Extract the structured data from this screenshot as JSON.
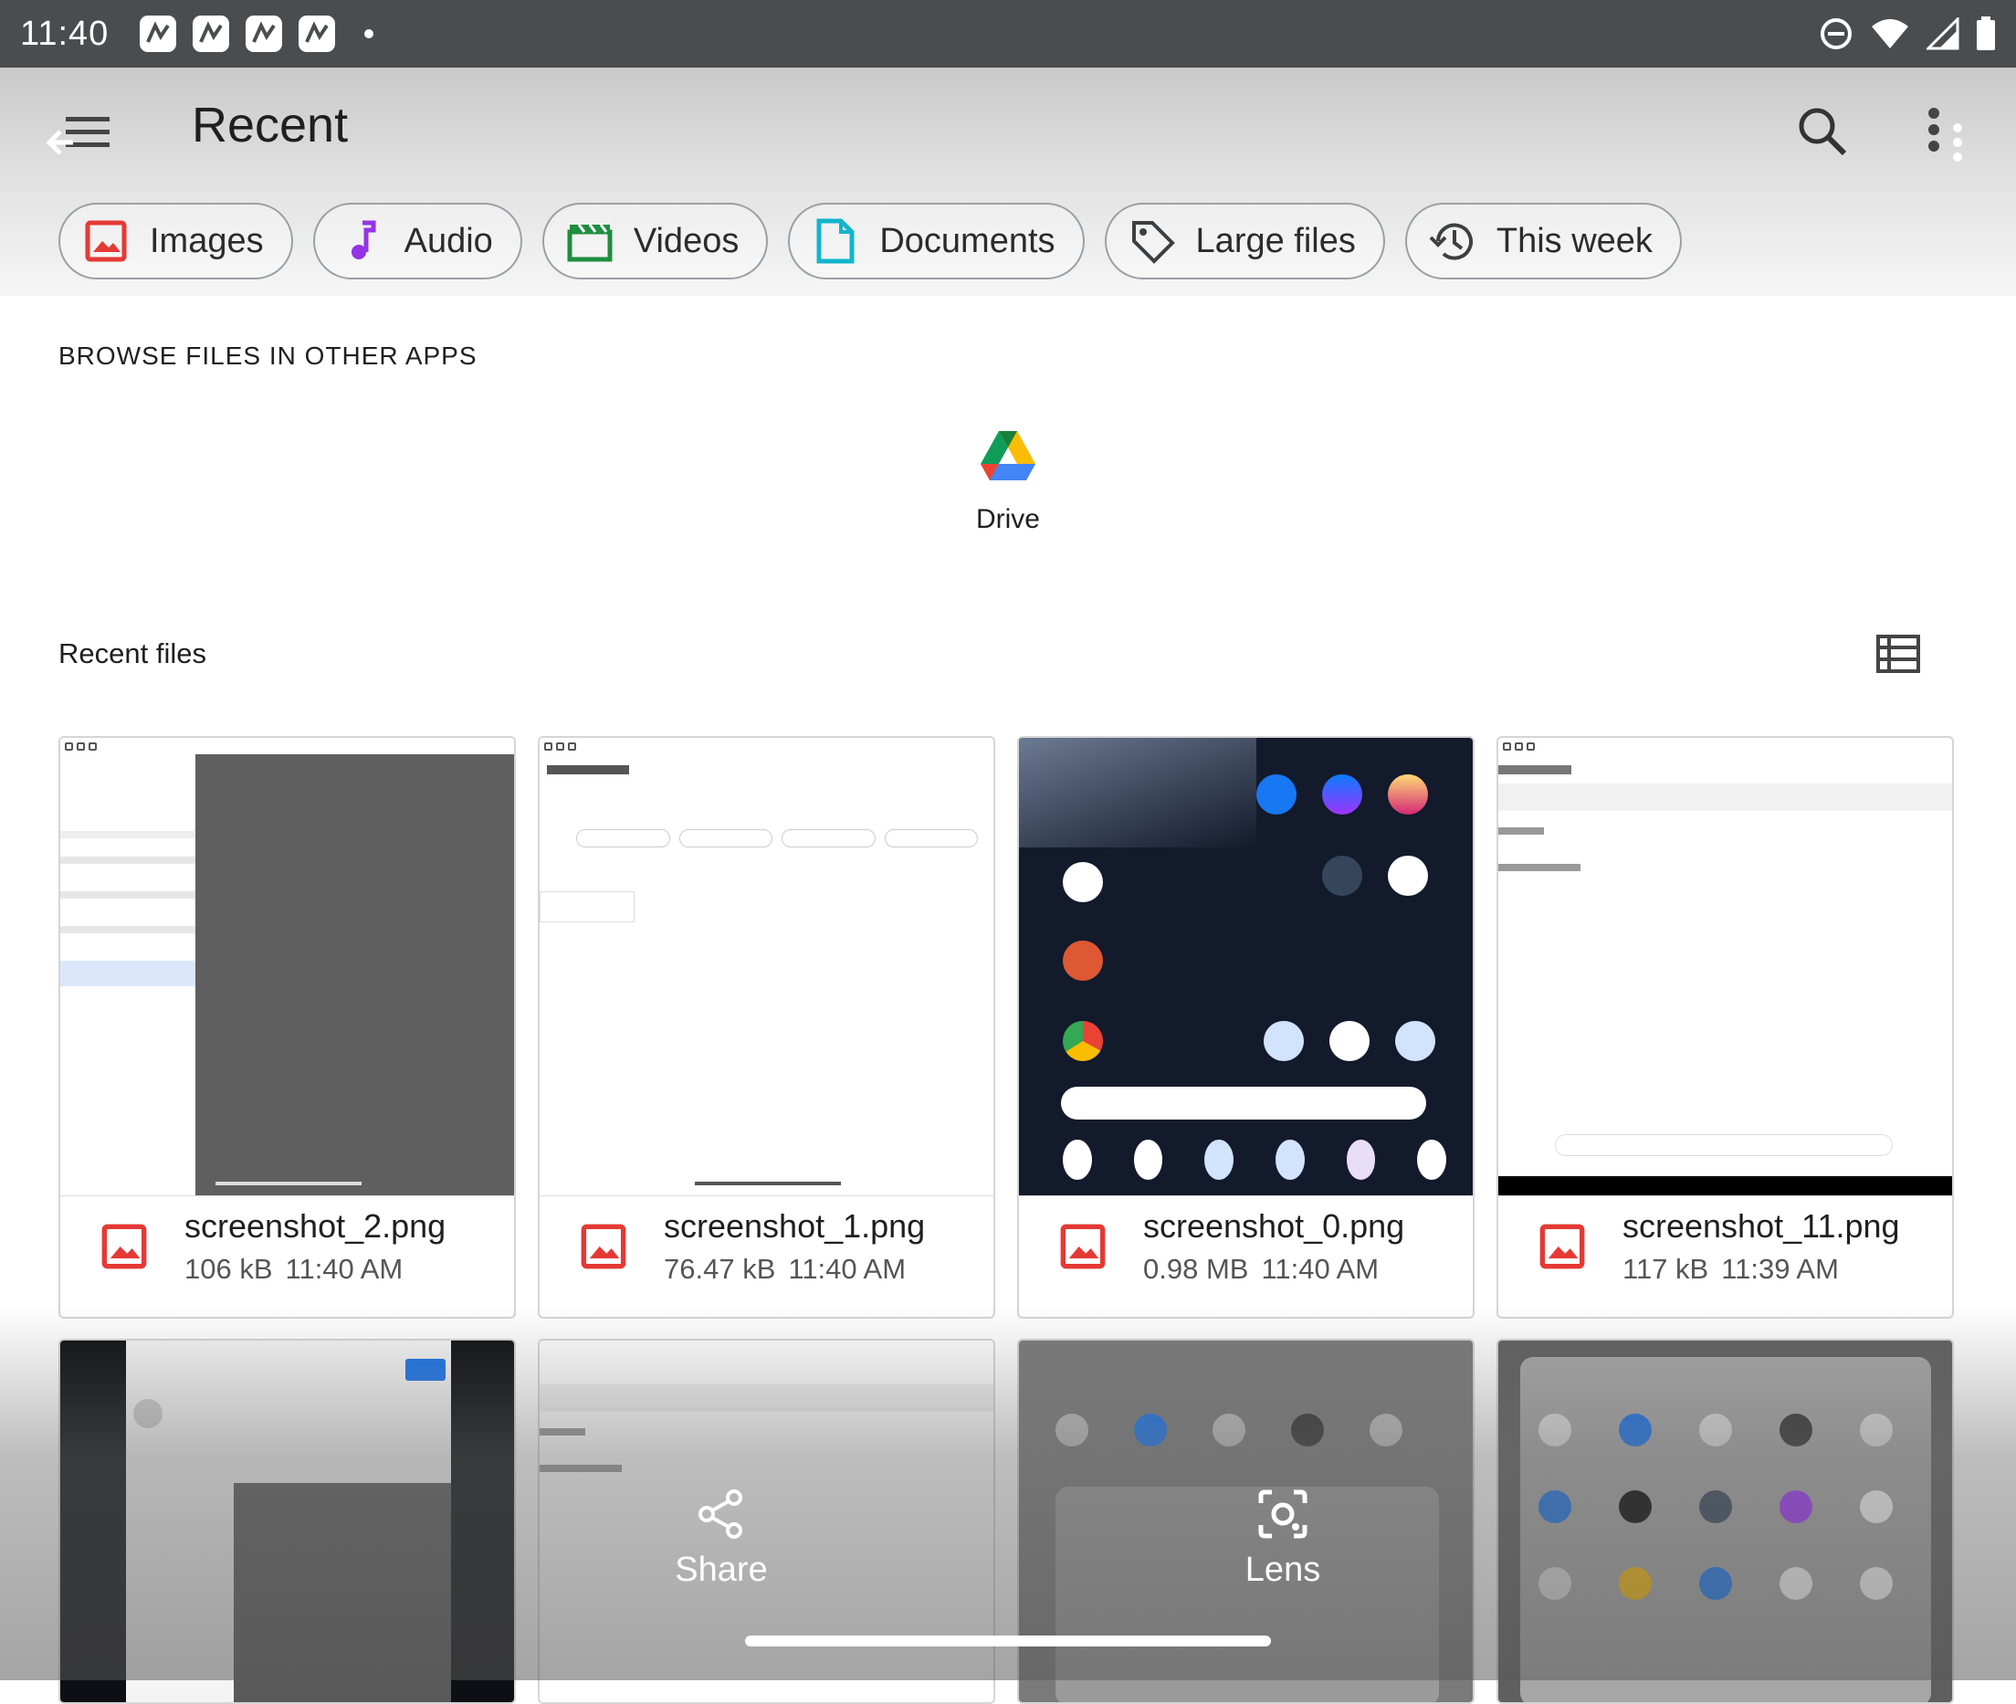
{
  "status_bar": {
    "time": "11:40"
  },
  "header": {
    "title": "Recent"
  },
  "chips": [
    {
      "label": "Images",
      "icon": "image-icon",
      "color": "#e53935"
    },
    {
      "label": "Audio",
      "icon": "music-note-icon",
      "color": "#9334e6"
    },
    {
      "label": "Videos",
      "icon": "clapperboard-icon",
      "color": "#1e8e3e"
    },
    {
      "label": "Documents",
      "icon": "document-icon",
      "color": "#12b5cb"
    },
    {
      "label": "Large files",
      "icon": "tag-icon",
      "color": "#3c4043"
    },
    {
      "label": "This week",
      "icon": "history-icon",
      "color": "#3c4043"
    }
  ],
  "browse": {
    "title": "BROWSE FILES IN OTHER APPS",
    "apps": [
      {
        "label": "Drive"
      }
    ]
  },
  "recent": {
    "title": "Recent files",
    "files": [
      {
        "name": "screenshot_2.png",
        "size": "106 kB",
        "time": "11:40 AM"
      },
      {
        "name": "screenshot_1.png",
        "size": "76.47 kB",
        "time": "11:40 AM"
      },
      {
        "name": "screenshot_0.png",
        "size": "0.98 MB",
        "time": "11:40 AM"
      },
      {
        "name": "screenshot_11.png",
        "size": "117 kB",
        "time": "11:39 AM"
      }
    ]
  },
  "actions": {
    "share": "Share",
    "lens": "Lens"
  },
  "colors": {
    "accent": "#1a73e8",
    "image_red": "#e53935",
    "status_bar": "#4a4d50"
  }
}
